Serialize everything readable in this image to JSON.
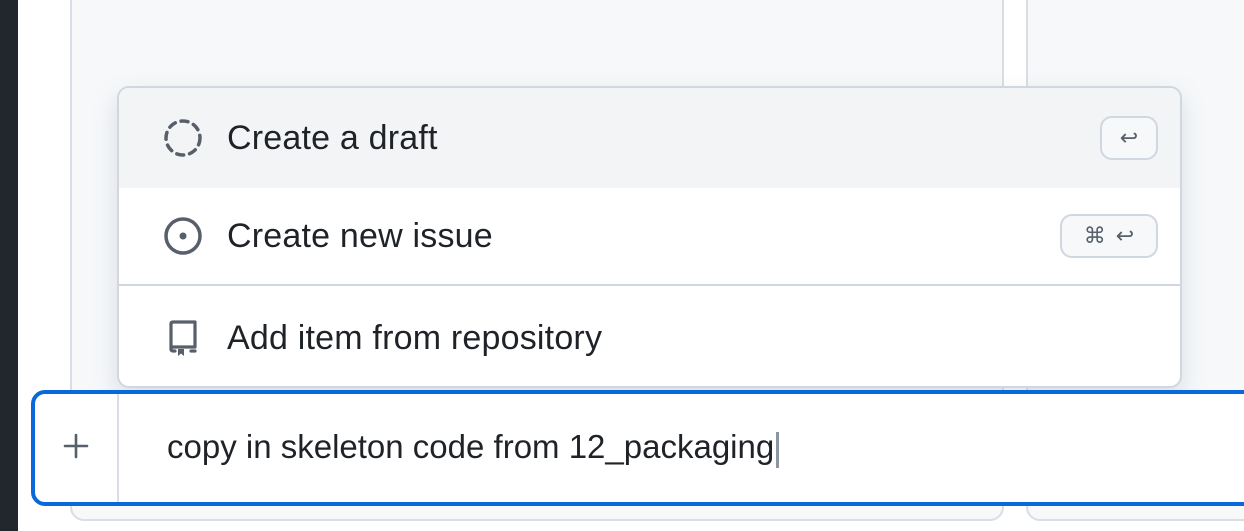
{
  "menu": {
    "items": [
      {
        "label": "Create a draft",
        "icon": "dashed-circle-icon",
        "shortcut": "↩"
      },
      {
        "label": "Create new issue",
        "icon": "issue-opened-icon",
        "shortcut_mod": "⌘",
        "shortcut_key": "↩"
      },
      {
        "label": "Add item from repository",
        "icon": "repo-icon"
      }
    ]
  },
  "input": {
    "value": "copy in skeleton code from 12_packaging",
    "add_icon": "plus-icon"
  },
  "colors": {
    "accent": "#0969da",
    "border": "#d0d7de",
    "text": "#1f2328",
    "active_bg": "#f3f4f6",
    "frame": "#22272e"
  }
}
